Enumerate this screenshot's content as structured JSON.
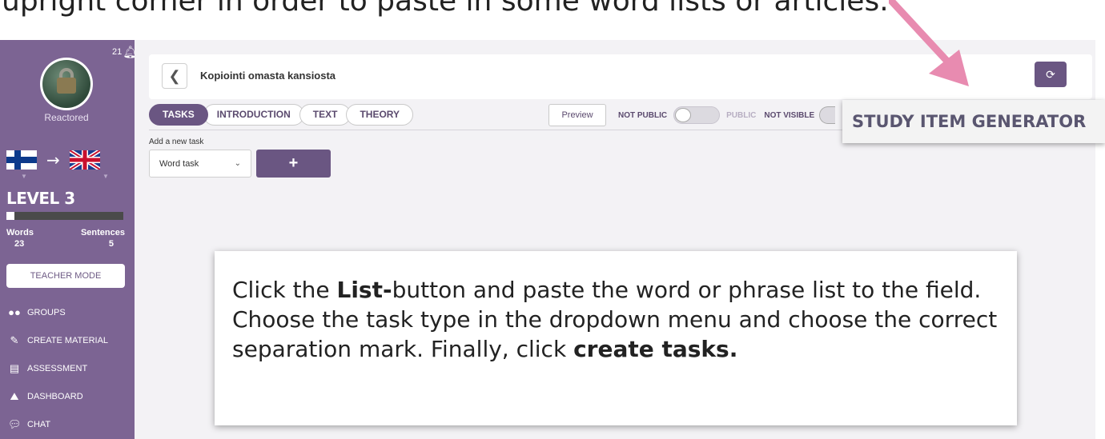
{
  "caption": {
    "text": "upright corner in order to paste in some word lists or articles."
  },
  "sidebar": {
    "notifications_count": "21",
    "username": "Reactored",
    "level": "LEVEL 3",
    "progress": 0.07,
    "stats": {
      "words_label": "Words",
      "sentences_label": "Sentences",
      "words_value": "23",
      "sentences_value": "5"
    },
    "teacher_mode_label": "TEACHER MODE",
    "nav": [
      {
        "label": "GROUPS",
        "icon": "groups-icon"
      },
      {
        "label": "CREATE MATERIAL",
        "icon": "pencil-icon"
      },
      {
        "label": "ASSESSMENT",
        "icon": "assessment-icon"
      },
      {
        "label": "DASHBOARD",
        "icon": "chart-icon"
      },
      {
        "label": "CHAT",
        "icon": "chat-icon"
      }
    ]
  },
  "header": {
    "title": "Kopiointi omasta kansiosta"
  },
  "tabs": [
    {
      "label": "TASKS",
      "active": true
    },
    {
      "label": "INTRODUCTION",
      "active": false
    },
    {
      "label": "TEXT",
      "active": false
    },
    {
      "label": "THEORY",
      "active": false
    }
  ],
  "toolbar": {
    "preview_label": "Preview",
    "not_public_label": "NOT PUBLIC",
    "public_label": "PUBLIC",
    "not_visible_label": "NOT VISIBLE"
  },
  "add_task": {
    "label": "Add a new task",
    "selected_type": "Word task",
    "add_symbol": "+"
  },
  "callout": {
    "text": "STUDY ITEM GENERATOR"
  },
  "instruction": {
    "part1": "Click the ",
    "bold1": "List-",
    "part2": "button and paste the word or phrase list to the field. Choose the task type in the dropdown menu and choose the correct separation mark. Finally, click ",
    "bold2": "create tasks."
  },
  "colors": {
    "sidebar_bg": "#7c6493",
    "accent": "#6a5682",
    "arrow_pink": "#e88bb0"
  }
}
